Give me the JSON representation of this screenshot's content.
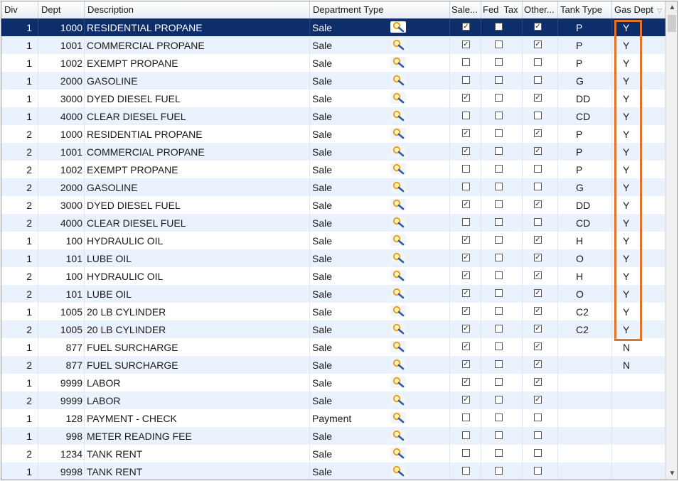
{
  "columns": {
    "div": "Div",
    "dept": "Dept",
    "description": "Description",
    "department_type": "Department Type",
    "sale": "Sale...",
    "fed_tax": "Fed  Tax",
    "other": "Other...",
    "tank_type": "Tank Type",
    "gas_dept": "Gas Dept"
  },
  "icons": {
    "sort": "sort-descending-icon",
    "lookup": "magnifier-lookup-icon",
    "check": "✓",
    "scroll_up": "▲",
    "scroll_down": "▼"
  },
  "colors": {
    "selected_row": "#0e2d6b",
    "alt_row": "#e9f2fd",
    "highlight_box": "#e07428"
  },
  "rows": [
    {
      "div": "1",
      "dept": "1000",
      "description": "RESIDENTIAL PROPANE",
      "type": "Sale",
      "sale": true,
      "fed_tax": false,
      "other": true,
      "tank_type": "P",
      "gas_dept": "Y",
      "selected": true
    },
    {
      "div": "1",
      "dept": "1001",
      "description": "COMMERCIAL PROPANE",
      "type": "Sale",
      "sale": true,
      "fed_tax": false,
      "other": true,
      "tank_type": "P",
      "gas_dept": "Y"
    },
    {
      "div": "1",
      "dept": "1002",
      "description": "EXEMPT PROPANE",
      "type": "Sale",
      "sale": false,
      "fed_tax": false,
      "other": false,
      "tank_type": "P",
      "gas_dept": "Y"
    },
    {
      "div": "1",
      "dept": "2000",
      "description": "GASOLINE",
      "type": "Sale",
      "sale": false,
      "fed_tax": false,
      "other": false,
      "tank_type": "G",
      "gas_dept": "Y"
    },
    {
      "div": "1",
      "dept": "3000",
      "description": "DYED DIESEL FUEL",
      "type": "Sale",
      "sale": true,
      "fed_tax": false,
      "other": true,
      "tank_type": "DD",
      "gas_dept": "Y"
    },
    {
      "div": "1",
      "dept": "4000",
      "description": "CLEAR DIESEL FUEL",
      "type": "Sale",
      "sale": false,
      "fed_tax": false,
      "other": false,
      "tank_type": "CD",
      "gas_dept": "Y"
    },
    {
      "div": "2",
      "dept": "1000",
      "description": "RESIDENTIAL PROPANE",
      "type": "Sale",
      "sale": true,
      "fed_tax": false,
      "other": true,
      "tank_type": "P",
      "gas_dept": "Y"
    },
    {
      "div": "2",
      "dept": "1001",
      "description": "COMMERCIAL PROPANE",
      "type": "Sale",
      "sale": true,
      "fed_tax": false,
      "other": true,
      "tank_type": "P",
      "gas_dept": "Y"
    },
    {
      "div": "2",
      "dept": "1002",
      "description": "EXEMPT PROPANE",
      "type": "Sale",
      "sale": false,
      "fed_tax": false,
      "other": false,
      "tank_type": "P",
      "gas_dept": "Y"
    },
    {
      "div": "2",
      "dept": "2000",
      "description": "GASOLINE",
      "type": "Sale",
      "sale": false,
      "fed_tax": false,
      "other": false,
      "tank_type": "G",
      "gas_dept": "Y"
    },
    {
      "div": "2",
      "dept": "3000",
      "description": "DYED DIESEL FUEL",
      "type": "Sale",
      "sale": true,
      "fed_tax": false,
      "other": true,
      "tank_type": "DD",
      "gas_dept": "Y"
    },
    {
      "div": "2",
      "dept": "4000",
      "description": "CLEAR DIESEL FUEL",
      "type": "Sale",
      "sale": false,
      "fed_tax": false,
      "other": false,
      "tank_type": "CD",
      "gas_dept": "Y"
    },
    {
      "div": "1",
      "dept": "100",
      "description": "HYDRAULIC OIL",
      "type": "Sale",
      "sale": true,
      "fed_tax": false,
      "other": true,
      "tank_type": "H",
      "gas_dept": "Y"
    },
    {
      "div": "1",
      "dept": "101",
      "description": "LUBE OIL",
      "type": "Sale",
      "sale": true,
      "fed_tax": false,
      "other": true,
      "tank_type": "O",
      "gas_dept": "Y"
    },
    {
      "div": "2",
      "dept": "100",
      "description": "HYDRAULIC OIL",
      "type": "Sale",
      "sale": true,
      "fed_tax": false,
      "other": true,
      "tank_type": "H",
      "gas_dept": "Y"
    },
    {
      "div": "2",
      "dept": "101",
      "description": "LUBE OIL",
      "type": "Sale",
      "sale": true,
      "fed_tax": false,
      "other": true,
      "tank_type": "O",
      "gas_dept": "Y"
    },
    {
      "div": "1",
      "dept": "1005",
      "description": "20 LB CYLINDER",
      "type": "Sale",
      "sale": true,
      "fed_tax": false,
      "other": true,
      "tank_type": "C2",
      "gas_dept": "Y"
    },
    {
      "div": "2",
      "dept": "1005",
      "description": "20 LB CYLINDER",
      "type": "Sale",
      "sale": true,
      "fed_tax": false,
      "other": true,
      "tank_type": "C2",
      "gas_dept": "Y"
    },
    {
      "div": "1",
      "dept": "877",
      "description": "FUEL SURCHARGE",
      "type": "Sale",
      "sale": true,
      "fed_tax": false,
      "other": true,
      "tank_type": "",
      "gas_dept": "N"
    },
    {
      "div": "2",
      "dept": "877",
      "description": "FUEL SURCHARGE",
      "type": "Sale",
      "sale": true,
      "fed_tax": false,
      "other": true,
      "tank_type": "",
      "gas_dept": "N"
    },
    {
      "div": "1",
      "dept": "9999",
      "description": "LABOR",
      "type": "Sale",
      "sale": true,
      "fed_tax": false,
      "other": true,
      "tank_type": "",
      "gas_dept": ""
    },
    {
      "div": "2",
      "dept": "9999",
      "description": "LABOR",
      "type": "Sale",
      "sale": true,
      "fed_tax": false,
      "other": true,
      "tank_type": "",
      "gas_dept": ""
    },
    {
      "div": "1",
      "dept": "128",
      "description": "PAYMENT - CHECK",
      "type": "Payment",
      "sale": false,
      "fed_tax": false,
      "other": false,
      "tank_type": "",
      "gas_dept": ""
    },
    {
      "div": "1",
      "dept": "998",
      "description": "METER READING FEE",
      "type": "Sale",
      "sale": false,
      "fed_tax": false,
      "other": false,
      "tank_type": "",
      "gas_dept": ""
    },
    {
      "div": "2",
      "dept": "1234",
      "description": "TANK RENT",
      "type": "Sale",
      "sale": false,
      "fed_tax": false,
      "other": false,
      "tank_type": "",
      "gas_dept": ""
    },
    {
      "div": "1",
      "dept": "9998",
      "description": "TANK RENT",
      "type": "Sale",
      "sale": false,
      "fed_tax": false,
      "other": false,
      "tank_type": "",
      "gas_dept": ""
    }
  ]
}
